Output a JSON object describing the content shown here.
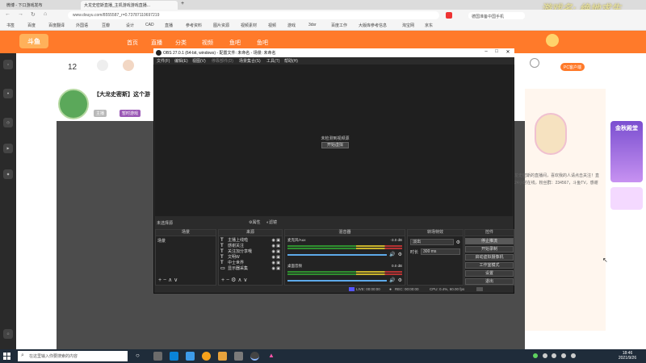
{
  "browser": {
    "tabs": [
      {
        "label": "微博 - 下口游戏发布"
      },
      {
        "label": "大龙史密斯直播_主机游戏游戏直播..."
      }
    ],
    "new_tab": "+",
    "url": "www.douyu.com/8555587_r=0.73787110697219",
    "bookmarks": [
      "书签",
      "百度",
      "百度翻译",
      "外国语",
      "豆瓣",
      "设计",
      "CAD",
      "直播",
      "参考资料",
      "图片资源",
      "视频素材",
      "视频",
      "游戏",
      "3dsr",
      "百度工作",
      "大版库参考信息",
      "淘宝网",
      "京东"
    ],
    "right_bookmark": "德国准备中国手机"
  },
  "watermark": "游戏名: 绝地求生",
  "site": {
    "nav": [
      "首页",
      "直播",
      "分类",
      "视频",
      "鱼吧",
      "鱼吧"
    ],
    "level": "12",
    "stream_title": "【大龙史密斯】这个游",
    "badges": [
      "主播",
      "暂时游戏"
    ],
    "chat_text": "欢迎来到大龙史密斯的直播间，喜欢我的人请点击关注！直播时间每天24小时在线，粉丝群：234567，斗鱼TV，感谢支持！",
    "promo": "金秋殿堂",
    "pc_button": "PC客户端"
  },
  "obs": {
    "title": "OBS 27.0.1 (64-bit, windows) - 配置文件: 未命名 - 场景: 未命名",
    "menu": [
      "文件(F)",
      "编辑(E)",
      "视图(V)",
      "停靠部件(D)",
      "场景集合(S)",
      "工具(T)",
      "帮助(H)"
    ],
    "preview_message": "未检测到视频源",
    "start_virtual": "开始虚拟",
    "no_scene": "未选择源",
    "props": [
      "属性",
      "滤镜"
    ],
    "docks": {
      "scenes": {
        "header": "场景",
        "items": [
          "场景"
        ]
      },
      "sources": {
        "header": "来源",
        "items": [
          {
            "label": "主播上线啦",
            "icon": "T"
          },
          {
            "label": "感谢关注",
            "icon": "T"
          },
          {
            "label": "关注加分享哦",
            "icon": "T"
          },
          {
            "label": "文明W",
            "icon": "T"
          },
          {
            "label": "中士世界",
            "icon": "T"
          },
          {
            "label": "显示器采集",
            "icon": "▭"
          }
        ]
      },
      "mixer": {
        "header": "混音器",
        "channels": [
          {
            "name": "麦克风/Aux",
            "db": "-3.0 dB"
          },
          {
            "name": "桌面音频",
            "db": "0.0 dB"
          }
        ]
      },
      "transitions": {
        "header": "转场特效",
        "mode": "淡出",
        "duration_label": "时长",
        "duration": "300 ms"
      },
      "controls": {
        "header": "控件",
        "buttons": [
          "停止推流",
          "开始录制",
          "启动虚拟摄像机",
          "工作室模式",
          "设置",
          "退出"
        ]
      }
    },
    "status": {
      "live": "LIVE: 00:00:00",
      "rec": "REC: 00:00:00",
      "cpu": "CPU: 0.4%, 60.00 fps"
    }
  },
  "taskbar": {
    "search_placeholder": "在这里输入你要搜索的内容",
    "time": "18:46",
    "date": "2021/9/26"
  }
}
